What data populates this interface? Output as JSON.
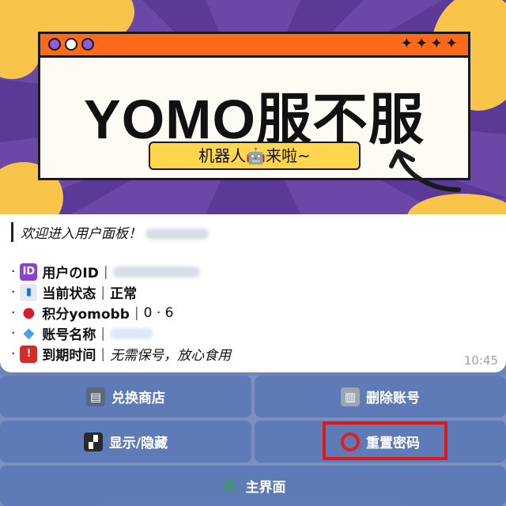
{
  "banner": {
    "title": "YOMO服不服",
    "subtitle": "机器人🤖来啦~",
    "stars": "✦✦✦✦",
    "colors": {
      "bg": "#6b48a8",
      "bar": "#ff6a1a",
      "pill": "#ffd64e"
    }
  },
  "message": {
    "welcome": "欢迎进入用户面板！",
    "rows": [
      {
        "icon": "id-icon",
        "label": "用户のID",
        "sep": "|",
        "value": ""
      },
      {
        "icon": "chart-icon",
        "label": "当前状态",
        "sep": "|",
        "value": "正常"
      },
      {
        "icon": "cherry-icon",
        "label": "积分yomobb",
        "sep": "|",
        "value": "0 · 6"
      },
      {
        "icon": "diamond-icon",
        "label": "账号名称",
        "sep": "|",
        "value": ""
      },
      {
        "icon": "siren-icon",
        "label": "到期时间",
        "sep": "|",
        "value": "无需保号，放心食用"
      }
    ],
    "time": "10:45"
  },
  "keyboard": {
    "exchange_shop": "兑换商店",
    "delete_account": "删除账号",
    "show_hide": "显示/隐藏",
    "reset_password": "重置密码",
    "main_menu": "主界面"
  }
}
